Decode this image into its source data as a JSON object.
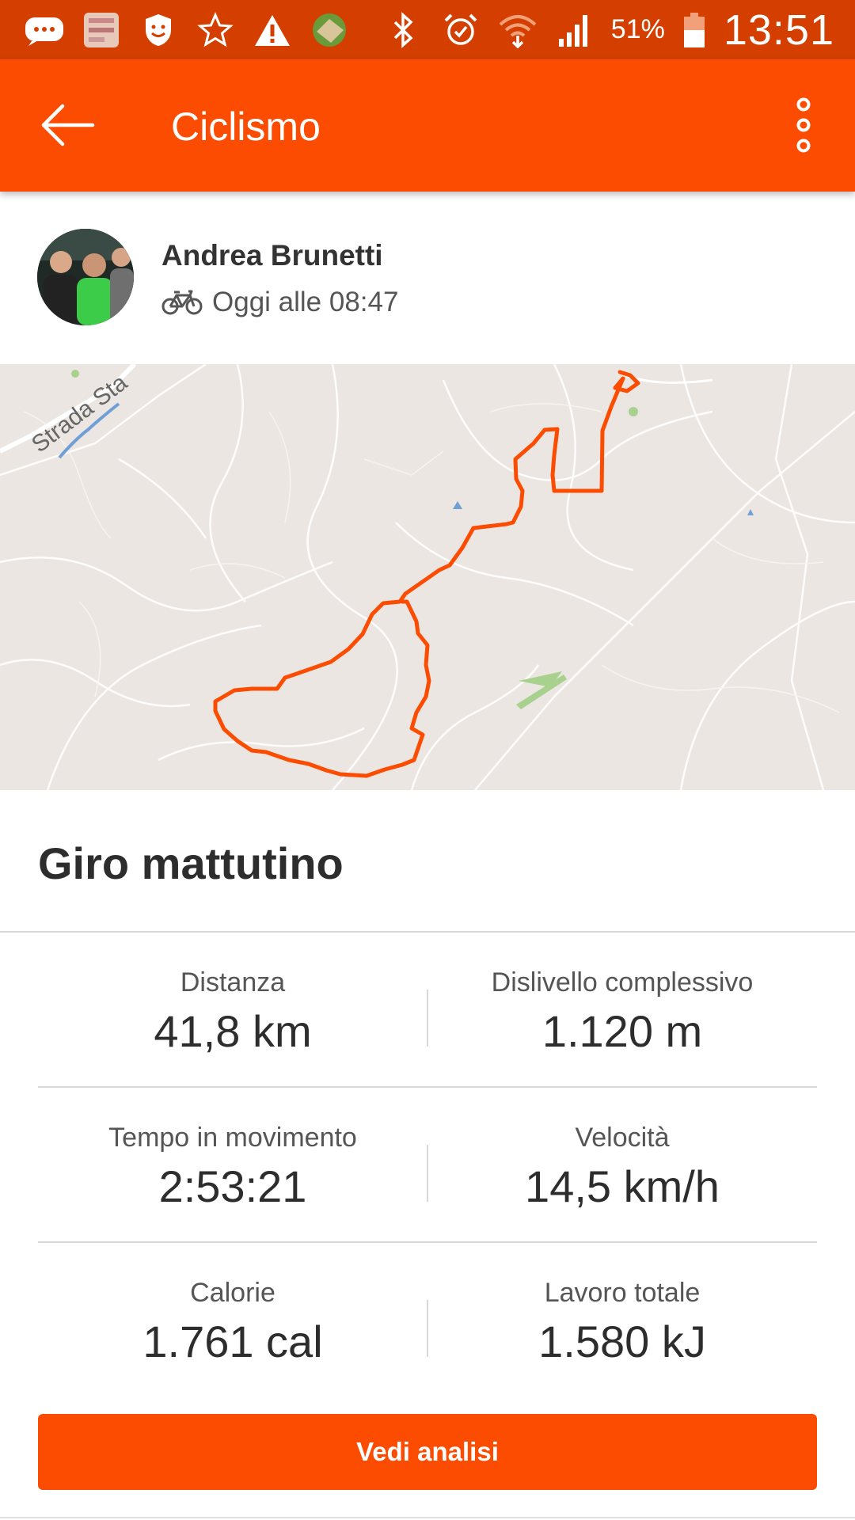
{
  "status_bar": {
    "battery_text": "51%",
    "time": "13:51",
    "background": "#d43f00"
  },
  "app_bar": {
    "title": "Ciclismo",
    "background": "#fc4c02"
  },
  "athlete": {
    "name": "Andrea Brunetti",
    "activity_icon": "bicycle-icon",
    "time_text": "Oggi alle 08:47"
  },
  "map": {
    "road_label": "Strada Sta",
    "route_color": "#fc4c02"
  },
  "activity": {
    "title": "Giro mattutino"
  },
  "stats": [
    {
      "left": {
        "label": "Distanza",
        "value": "41,8 km"
      },
      "right": {
        "label": "Dislivello complessivo",
        "value": "1.120 m"
      }
    },
    {
      "left": {
        "label": "Tempo in movimento",
        "value": "2:53:21"
      },
      "right": {
        "label": "Velocità",
        "value": "14,5 km/h"
      }
    },
    {
      "left": {
        "label": "Calorie",
        "value": "1.761 cal"
      },
      "right": {
        "label": "Lavoro totale",
        "value": "1.580 kJ"
      }
    }
  ],
  "cta": {
    "label": "Vedi analisi"
  }
}
